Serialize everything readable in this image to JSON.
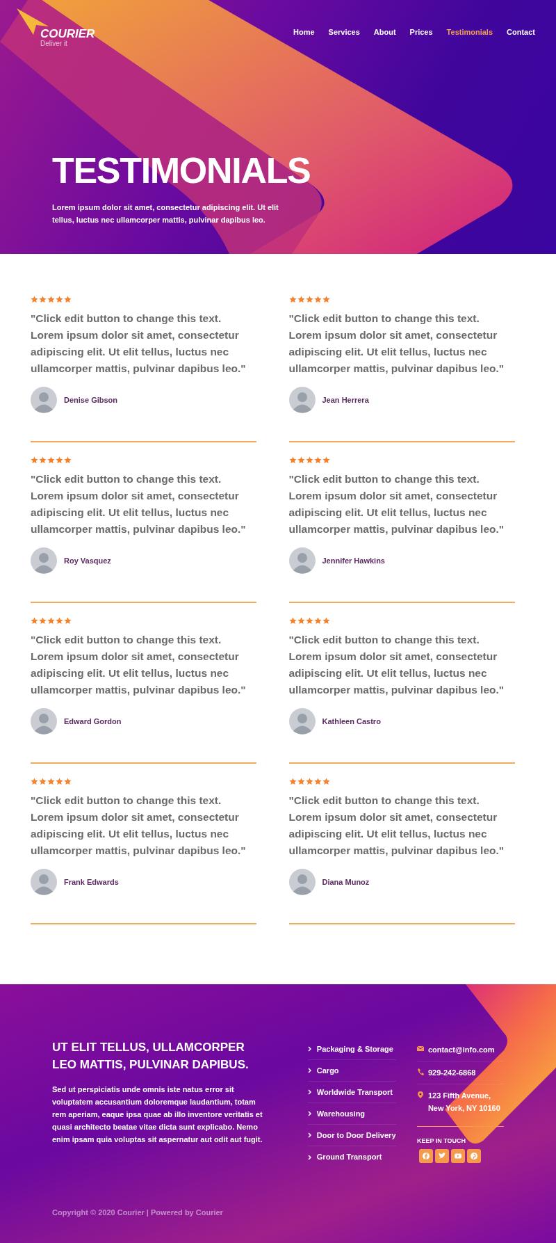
{
  "header": {
    "logo": {
      "name": "COURIER",
      "tagline": "Deliver it"
    },
    "nav": [
      {
        "label": "Home",
        "selected": false
      },
      {
        "label": "Services",
        "selected": false
      },
      {
        "label": "About",
        "selected": false
      },
      {
        "label": "Prices",
        "selected": false
      },
      {
        "label": "Testimonials",
        "selected": true
      },
      {
        "label": "Contact",
        "selected": false
      }
    ]
  },
  "hero": {
    "title": "TESTIMONIALS",
    "subtitle": "Lorem ipsum dolor sit amet, consectetur adipiscing elit. Ut elit tellus, luctus nec ullamcorper mattis, pulvinar dapibus leo."
  },
  "testimonials": [
    {
      "stars": 5,
      "quote": "\"Click edit button to change this text. Lorem ipsum dolor sit amet, consectetur adipiscing elit. Ut elit tellus, luctus nec ullamcorper mattis, pulvinar dapibus leo.\"",
      "name": "Denise Gibson"
    },
    {
      "stars": 5,
      "quote": "\"Click edit button to change this text. Lorem ipsum dolor sit amet, consectetur adipiscing elit. Ut elit tellus, luctus nec ullamcorper mattis, pulvinar dapibus leo.\"",
      "name": "Jean Herrera"
    },
    {
      "stars": 5,
      "quote": "\"Click edit button to change this text. Lorem ipsum dolor sit amet, consectetur adipiscing elit. Ut elit tellus, luctus nec ullamcorper mattis, pulvinar dapibus leo.\"",
      "name": "Roy Vasquez"
    },
    {
      "stars": 5,
      "quote": "\"Click edit button to change this text. Lorem ipsum dolor sit amet, consectetur adipiscing elit. Ut elit tellus, luctus nec ullamcorper mattis, pulvinar dapibus leo.\"",
      "name": "Jennifer Hawkins"
    },
    {
      "stars": 5,
      "quote": "\"Click edit button to change this text. Lorem ipsum dolor sit amet, consectetur adipiscing elit. Ut elit tellus, luctus nec ullamcorper mattis, pulvinar dapibus leo.\"",
      "name": "Edward Gordon"
    },
    {
      "stars": 5,
      "quote": "\"Click edit button to change this text. Lorem ipsum dolor sit amet, consectetur adipiscing elit. Ut elit tellus, luctus nec ullamcorper mattis, pulvinar dapibus leo.\"",
      "name": "Kathleen Castro"
    },
    {
      "stars": 5,
      "quote": "\"Click edit button to change this text. Lorem ipsum dolor sit amet, consectetur adipiscing elit. Ut elit tellus, luctus nec ullamcorper mattis, pulvinar dapibus leo.\"",
      "name": "Frank Edwards"
    },
    {
      "stars": 5,
      "quote": "\"Click edit button to change this text. Lorem ipsum dolor sit amet, consectetur adipiscing elit. Ut elit tellus, luctus nec ullamcorper mattis, pulvinar dapibus leo.\"",
      "name": "Diana Munoz"
    }
  ],
  "footer": {
    "heading": "UT ELIT TELLUS, ULLAMCORPER LEO MATTIS, PULVINAR DAPIBUS.",
    "text": "Sed ut perspiciatis unde omnis iste natus error sit voluptatem accusantium doloremque laudantium, totam rem aperiam, eaque ipsa quae ab illo inventore veritatis et quasi architecto beatae vitae dicta sunt explicabo. Nemo enim ipsam quia voluptas sit aspernatur aut odit aut fugit.",
    "links": [
      "Packaging & Storage",
      "Cargo",
      "Worldwide Transport",
      "Warehousing",
      "Door to Door Delivery",
      "Ground Transport"
    ],
    "contacts": [
      {
        "kind": "email",
        "text": "contact@info.com"
      },
      {
        "kind": "phone",
        "text": "929-242-6868"
      },
      {
        "kind": "address",
        "text": "123 Fifth Avenue, New York, NY 10160"
      }
    ],
    "social_heading": "KEEP IN TOUCH",
    "social": [
      {
        "kind": "facebook"
      },
      {
        "kind": "twitter"
      },
      {
        "kind": "youtube"
      },
      {
        "kind": "pinterest"
      }
    ],
    "copyright": "Copyright © 2020 Courier | Powered by Courier"
  }
}
